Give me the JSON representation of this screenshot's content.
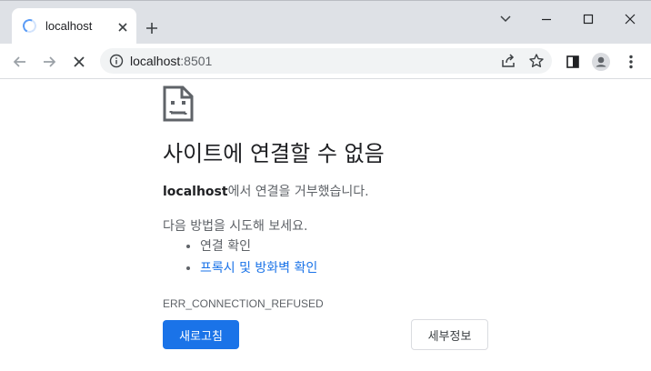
{
  "tab": {
    "title": "localhost"
  },
  "toolbar": {
    "url_host": "localhost",
    "url_port": ":8501"
  },
  "error_page": {
    "heading": "사이트에 연결할 수 없음",
    "host": "localhost",
    "message_suffix": "에서 연결을 거부했습니다.",
    "suggest_intro": "다음 방법을 시도해 보세요.",
    "suggestions": [
      {
        "label": "연결 확인",
        "is_link": false
      },
      {
        "label": "프록시 및 방화벽 확인",
        "is_link": true
      }
    ],
    "error_code": "ERR_CONNECTION_REFUSED",
    "reload_label": "새로고침",
    "details_label": "세부정보"
  },
  "colors": {
    "accent": "#1a73e8",
    "tabstrip": "#dee1e6",
    "omnibox": "#f1f3f4"
  },
  "icons": {
    "tab_loading": "loading-spinner-icon",
    "error": "sad-document-icon"
  }
}
